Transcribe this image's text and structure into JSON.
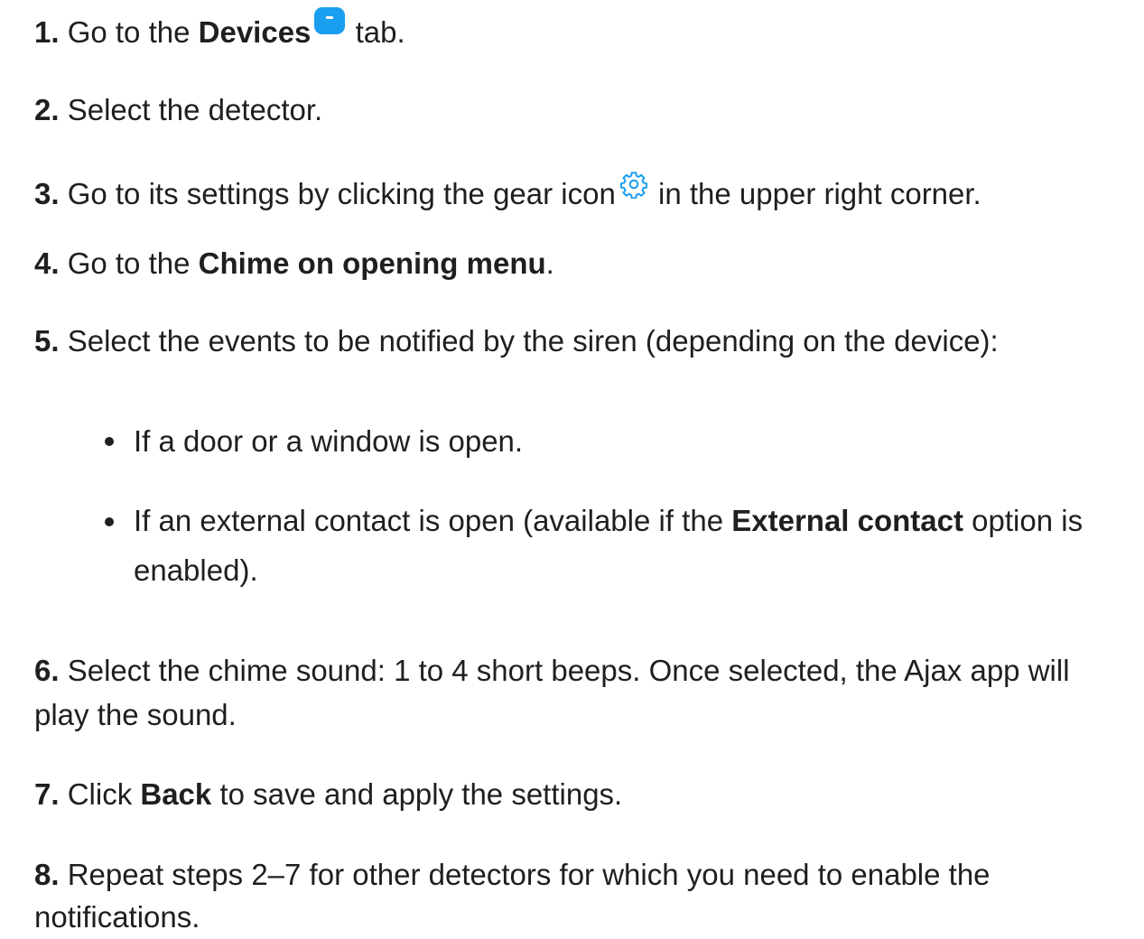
{
  "steps": [
    {
      "num": "1.",
      "pre": "Go to the ",
      "bold": "Devices",
      "post": " tab."
    },
    {
      "num": "2.",
      "text": "Select the detector."
    },
    {
      "num": "3.",
      "pre": "Go to its settings by clicking the gear icon",
      "post": " in the upper right corner."
    },
    {
      "num": "4.",
      "pre": "Go to the ",
      "bold": "Chime on opening menu",
      "post": "."
    },
    {
      "num": "5.",
      "text": "Select the events to be notified by the siren (depending on the device):"
    },
    {
      "num": "6.",
      "line1": "Select the chime sound: 1 to 4 short beeps. Once selected, the Ajax app will",
      "line2": "play the sound."
    },
    {
      "num": "7.",
      "pre": "Click ",
      "bold": "Back",
      "post": " to save and apply the settings."
    },
    {
      "num": "8.",
      "line1": "Repeat steps 2–7 for other detectors for which you need to enable the",
      "line2": "notifications."
    }
  ],
  "bullets": [
    {
      "text": "If a door or a window is open."
    },
    {
      "pre": "If an external contact is open (available if the ",
      "bold": "External contact",
      "post": " option is",
      "line2": "enabled)."
    }
  ],
  "icons": {
    "devices": "devices-tab-icon",
    "gear": "gear-icon",
    "accent": "#1a9ef0"
  }
}
